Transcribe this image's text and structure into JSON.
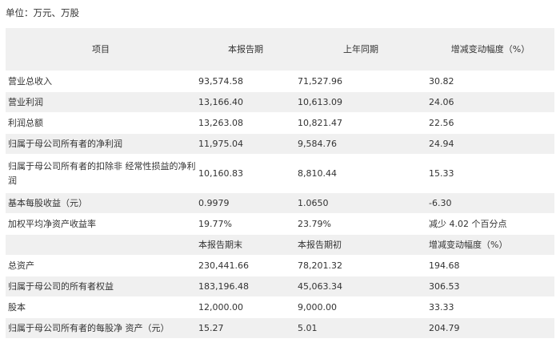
{
  "unit_note": "单位：万元、万股",
  "header": {
    "col1": "项目",
    "col2": "本报告期",
    "col3": "上年同期",
    "col4": "增减变动幅度（%）"
  },
  "rows": [
    {
      "item": "营业总收入",
      "current": "93,574.58",
      "previous": "71,527.96",
      "change": "30.82"
    },
    {
      "item": "营业利润",
      "current": "13,166.40",
      "previous": "10,613.09",
      "change": "24.06"
    },
    {
      "item": "利润总额",
      "current": "13,263.08",
      "previous": "10,821.47",
      "change": "22.56"
    },
    {
      "item": "归属于母公司所有者的净利润",
      "current": "11,975.04",
      "previous": "9,584.76",
      "change": "24.94"
    },
    {
      "item": "归属于母公司所有者的扣除非 经常性损益的净利润",
      "current": "10,160.83",
      "previous": "8,810.44",
      "change": "15.33"
    },
    {
      "item": "基本每股收益（元）",
      "current": "0.9979",
      "previous": "1.0650",
      "change": "-6.30"
    },
    {
      "item": "加权平均净资产收益率",
      "current": "19.77%",
      "previous": "23.79%",
      "change": "减少 4.02 个百分点"
    },
    {
      "item": "",
      "current": "本报告期末",
      "previous": "本报告期初",
      "change": "增减变动幅度（%）"
    },
    {
      "item": "总资产",
      "current": "230,441.66",
      "previous": "78,201.32",
      "change": "194.68"
    },
    {
      "item": "归属于母公司的所有者权益",
      "current": "183,196.48",
      "previous": "45,063.34",
      "change": "306.53"
    },
    {
      "item": "股本",
      "current": "12,000.00",
      "previous": "9,000.00",
      "change": "33.33"
    },
    {
      "item": "归属于母公司所有者的每股净 资产（元）",
      "current": "15.27",
      "previous": "5.01",
      "change": "204.79"
    }
  ]
}
